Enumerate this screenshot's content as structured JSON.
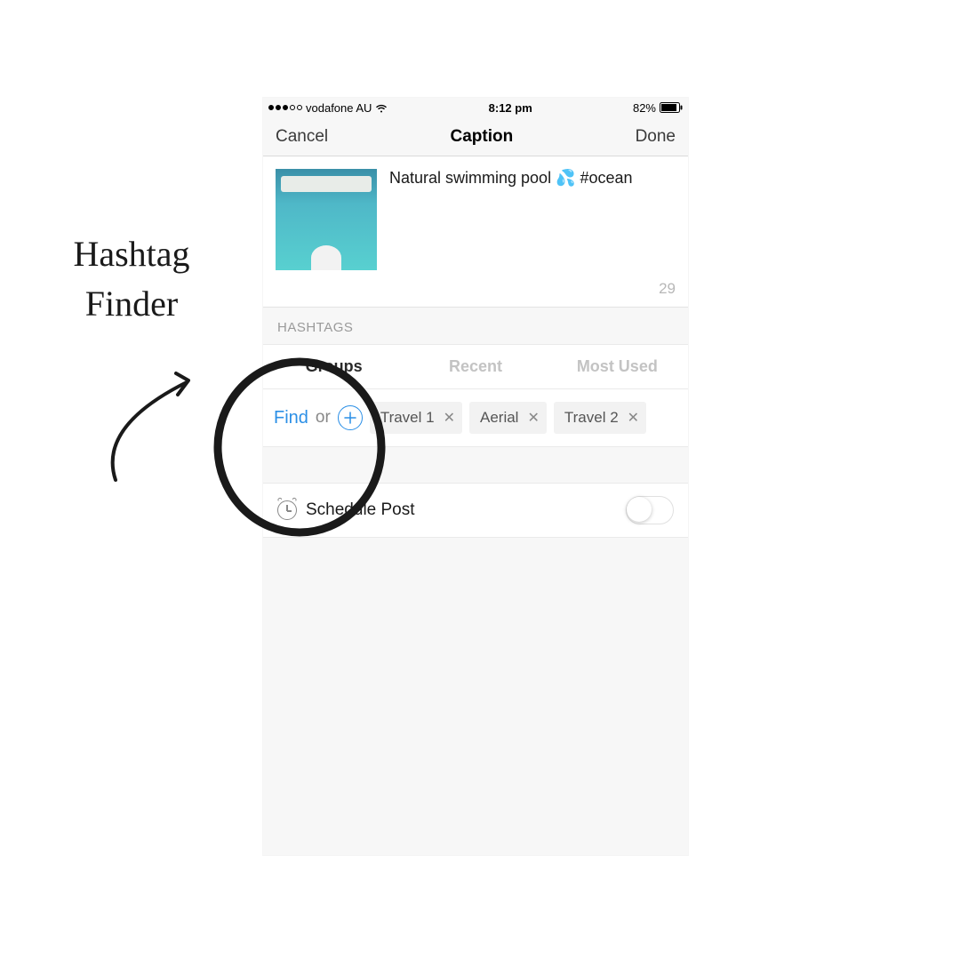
{
  "annotation": {
    "line1": "Hashtag",
    "line2": "Finder"
  },
  "status_bar": {
    "carrier": "vodafone AU",
    "time": "8:12 pm",
    "battery": "82%"
  },
  "nav": {
    "cancel": "Cancel",
    "title": "Caption",
    "done": "Done"
  },
  "caption": {
    "text": "Natural swimming pool 💦 #ocean",
    "count": "29"
  },
  "section_header": "HASHTAGS",
  "tabs": {
    "groups": "Groups",
    "recent": "Recent",
    "most_used": "Most Used"
  },
  "chip_row": {
    "find": "Find",
    "or": "or",
    "chips": [
      {
        "label": "Travel 1"
      },
      {
        "label": "Aerial"
      },
      {
        "label": "Travel 2"
      }
    ]
  },
  "schedule": {
    "label": "Schedule Post"
  }
}
